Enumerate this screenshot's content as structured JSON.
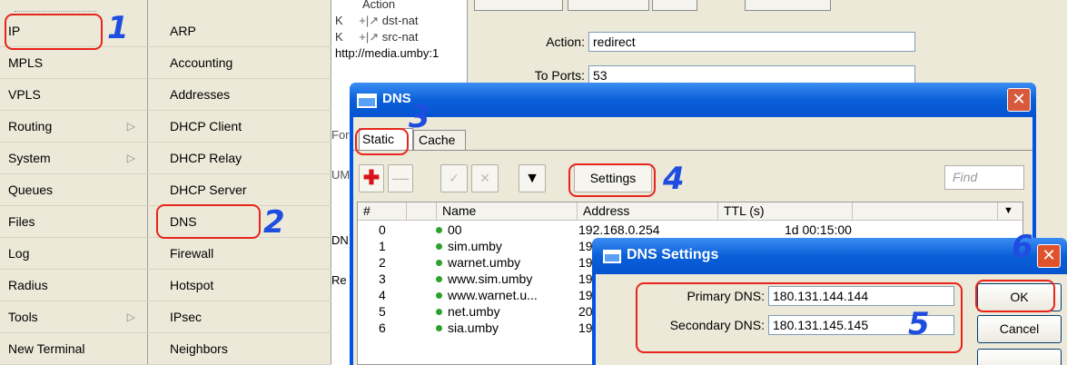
{
  "menu_primary": [
    {
      "label": "IP",
      "submenu": false
    },
    {
      "label": "MPLS",
      "submenu": false
    },
    {
      "label": "VPLS",
      "submenu": false
    },
    {
      "label": "Routing",
      "submenu": true
    },
    {
      "label": "System",
      "submenu": true
    },
    {
      "label": "Queues",
      "submenu": false
    },
    {
      "label": "Files",
      "submenu": false
    },
    {
      "label": "Log",
      "submenu": false
    },
    {
      "label": "Radius",
      "submenu": false
    },
    {
      "label": "Tools",
      "submenu": true
    },
    {
      "label": "New Terminal",
      "submenu": false
    }
  ],
  "menu_ip": [
    "ARP",
    "Accounting",
    "Addresses",
    "DHCP Client",
    "DHCP Relay",
    "DHCP Server",
    "DNS",
    "Firewall",
    "Hotspot",
    "IPsec",
    "Neighbors"
  ],
  "background": {
    "column_header": "Action",
    "rules": [
      "dst-nat",
      "src-nat",
      "http://media.umby:1"
    ],
    "side_fragments": [
      "For",
      "UM",
      "DN",
      "Re"
    ],
    "form": {
      "action_label": "Action:",
      "action_value": "redirect",
      "ports_label": "To Ports:",
      "ports_value": "53"
    }
  },
  "dns_window": {
    "title": "DNS",
    "tabs": [
      "Static",
      "Cache"
    ],
    "settings_button": "Settings",
    "find_placeholder": "Find",
    "columns": [
      "#",
      "Name",
      "Address",
      "TTL (s)"
    ],
    "rows": [
      {
        "num": "0",
        "name": "00",
        "address": "192.168.0.254",
        "ttl": "1d 00:15:00"
      },
      {
        "num": "1",
        "name": "sim.umby",
        "address": "19"
      },
      {
        "num": "2",
        "name": "warnet.umby",
        "address": "19"
      },
      {
        "num": "3",
        "name": "www.sim.umby",
        "address": "19"
      },
      {
        "num": "4",
        "name": "www.warnet.u...",
        "address": "19"
      },
      {
        "num": "5",
        "name": "net.umby",
        "address": "20"
      },
      {
        "num": "6",
        "name": "sia.umby",
        "address": "19"
      }
    ]
  },
  "settings_dialog": {
    "title": "DNS Settings",
    "primary_label": "Primary DNS:",
    "primary_value": "180.131.144.144",
    "secondary_label": "Secondary DNS:",
    "secondary_value": "180.131.145.145",
    "ok_label": "OK",
    "cancel_label": "Cancel"
  },
  "step_numbers": [
    "1",
    "2",
    "3",
    "4",
    "5",
    "6"
  ],
  "colors": {
    "highlight": "#e8241c",
    "step_number": "#1f4de0",
    "titlebar": "#0a5fd8",
    "close": "#e0522c"
  }
}
